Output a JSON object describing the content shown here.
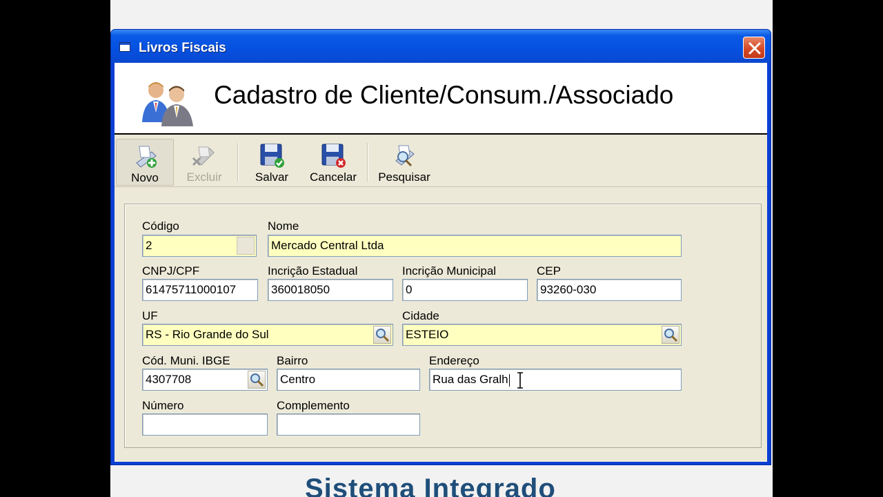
{
  "window": {
    "title": "Livros Fiscais"
  },
  "header": {
    "title": "Cadastro de Cliente/Consum./Associado"
  },
  "toolbar": {
    "novo": "Novo",
    "excluir": "Excluir",
    "salvar": "Salvar",
    "cancelar": "Cancelar",
    "pesquisar": "Pesquisar"
  },
  "form": {
    "codigo": {
      "label": "Código",
      "value": "2"
    },
    "nome": {
      "label": "Nome",
      "value": "Mercado Central Ltda"
    },
    "cnpj": {
      "label": "CNPJ/CPF",
      "value": "61475711000107"
    },
    "ie": {
      "label": "Incrição Estadual",
      "value": "360018050"
    },
    "im": {
      "label": "Incrição Municipal",
      "value": "0"
    },
    "cep": {
      "label": "CEP",
      "value": "93260-030"
    },
    "uf": {
      "label": "UF",
      "value": "RS - Rio Grande do Sul"
    },
    "cidade": {
      "label": "Cidade",
      "value": "ESTEIO"
    },
    "ibge": {
      "label": "Cód. Muni. IBGE",
      "value": "4307708"
    },
    "bairro": {
      "label": "Bairro",
      "value": "Centro"
    },
    "endereco": {
      "label": "Endereço",
      "value": "Rua das Gralh"
    },
    "numero": {
      "label": "Número",
      "value": ""
    },
    "complemento": {
      "label": "Complemento",
      "value": ""
    }
  },
  "footer": {
    "text": "Sistema Integrado"
  },
  "colors": {
    "titlebar": "#0550e0",
    "required_field": "#ffffc0",
    "dialog_bg": "#ece9d8"
  },
  "icons": [
    "window-app-icon",
    "close-icon",
    "users-icon",
    "new-record-icon",
    "delete-record-icon",
    "save-icon",
    "cancel-icon",
    "search-icon",
    "lookup-icon"
  ]
}
